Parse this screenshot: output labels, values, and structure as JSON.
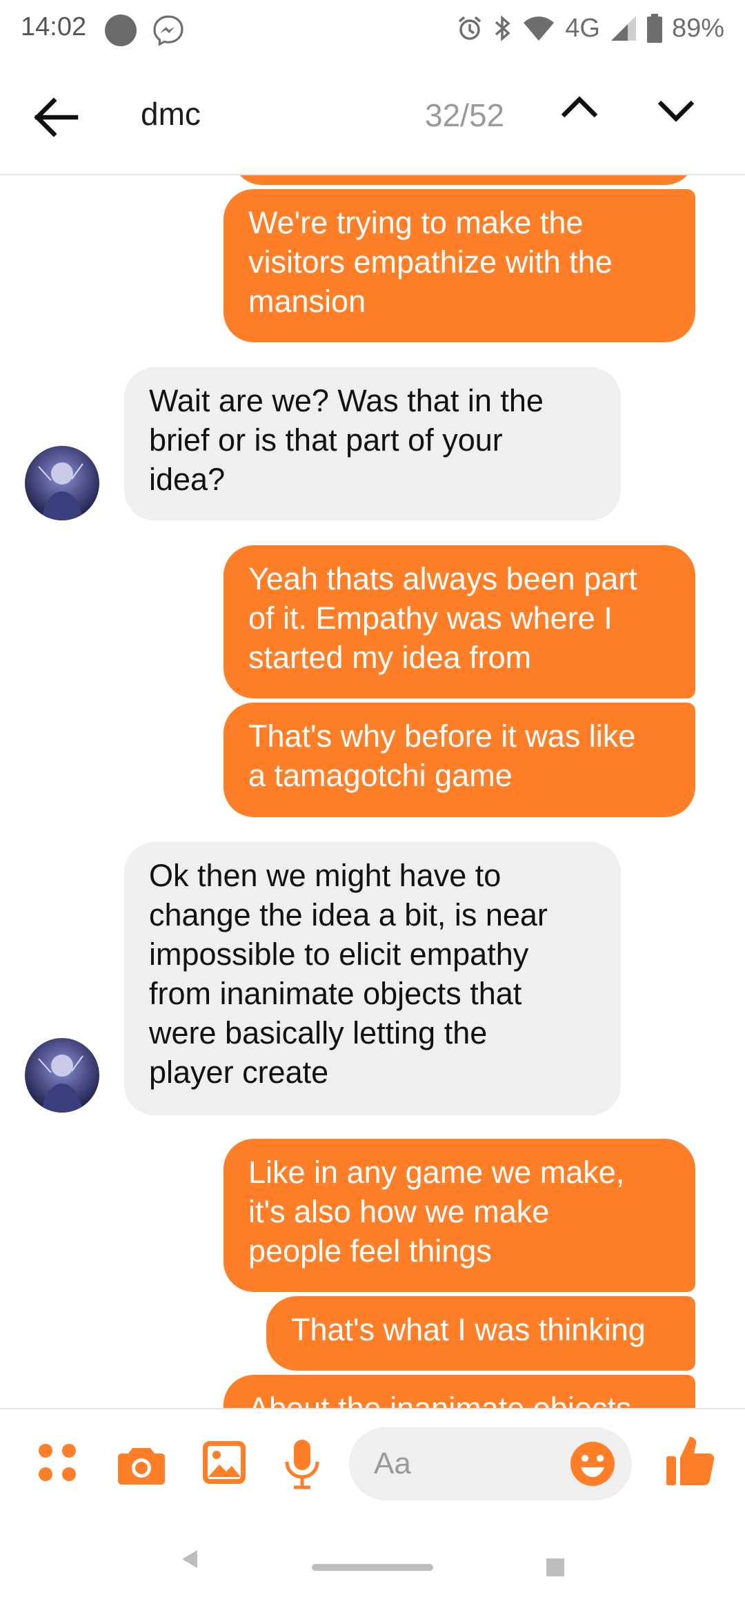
{
  "status_bar": {
    "time": "14:02",
    "network": "4G",
    "battery": "89%",
    "icons": [
      "notification-dot-icon",
      "messenger-icon",
      "alarm-icon",
      "bluetooth-icon",
      "wifi-icon",
      "signal-icon",
      "battery-icon"
    ]
  },
  "header": {
    "search_term": "dmc",
    "match_counter": "32/52",
    "icons": [
      "back-arrow-icon",
      "chevron-up-icon",
      "chevron-down-icon"
    ]
  },
  "messages": [
    {
      "side": "out",
      "text": ""
    },
    {
      "side": "out",
      "text": "We're trying to make the\nvisitors empathize with the\nmansion"
    },
    {
      "side": "in",
      "text": "Wait are we? Was that in the\nbrief or is that part of your\nidea?"
    },
    {
      "side": "out",
      "text": "Yeah thats always been part\nof it. Empathy was where I\nstarted my idea from"
    },
    {
      "side": "out",
      "text": "That's why before it was like\na tamagotchi game"
    },
    {
      "side": "in",
      "text": "Ok then we might have to\nchange the idea a bit, is near\nimpossible to elicit empathy\nfrom inanimate objects that\nwere basically letting the\nplayer create"
    },
    {
      "side": "out",
      "text": "Like in any game we make,\nit's also how we make\npeople feel things"
    },
    {
      "side": "out",
      "text": "That's what I was thinking"
    },
    {
      "side": "out",
      "text": "About the inanimate objects"
    }
  ],
  "composer": {
    "placeholder": "Aa",
    "icons": [
      "apps-icon",
      "camera-icon",
      "gallery-icon",
      "microphone-icon",
      "emoji-icon",
      "thumbs-up-icon"
    ]
  },
  "colors": {
    "accent": "#ff7f28",
    "incoming_bubble": "#efefef",
    "status_text": "#6e6e6e"
  }
}
